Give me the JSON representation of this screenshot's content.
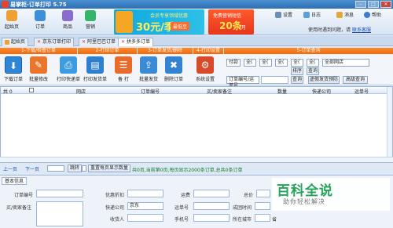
{
  "window": {
    "title": "易掌柜-订单打印 5.75"
  },
  "ribbon": {
    "buttons": [
      "起始页",
      "订单",
      "商品",
      "营销"
    ],
    "banner1": {
      "line1": "会员专享领域优惠",
      "price": "30元/季",
      "tag": "最低至"
    },
    "banner2": {
      "line1": "免费营销短信",
      "count": "20条",
      "unit": "/月"
    },
    "tools": [
      "设置",
      "日志",
      "消息",
      "帮助"
    ],
    "help_text": "使用时遇到问题，请",
    "help_link": "联系客服"
  },
  "tabs": [
    "起始页",
    "京东订单打印",
    "阿里巴巴订单",
    "拼多多订单"
  ],
  "groups": [
    "1-下载/检查订单",
    "2-打印订单",
    "3-订单发货/删除",
    "4-打印设置",
    "5-订单查询"
  ],
  "toolbar": [
    "下载订单",
    "批量修改",
    "打印快递单",
    "打印发货单",
    "备 打",
    "批量发货",
    "删除订单",
    "系统设置"
  ],
  "filters": {
    "row1": [
      "付款",
      "全(",
      "全(",
      "全(",
      "全(",
      "全(",
      "全部网店"
    ],
    "search_field": "订单编号/运单号",
    "buttons": [
      "排序",
      "查询",
      "查询",
      "虚假发货预防",
      "高级查询"
    ]
  },
  "table": {
    "columns": [
      "共 0",
      "网店",
      "订单编号",
      "买/卖家备注",
      "数量",
      "快递公司",
      "运单号"
    ]
  },
  "pager": {
    "prev": "上一页",
    "next": "下一页",
    "jump": "跳转",
    "page_size": "重置每页显示数量",
    "status": "共0页,当前第0页,每页显示2000条订单,总共0条订单"
  },
  "detail": {
    "tab": "基本信息",
    "labels": [
      "订单编号",
      "买/卖家备注",
      "优惠折扣",
      "运费",
      "总价",
      "快递公司",
      "运单号",
      "成团时间",
      "收货人",
      "手机号",
      "所在城市",
      "省"
    ],
    "courier_value": "京东"
  },
  "watermark": {
    "title": "百科全说",
    "subtitle": "助你轻松解决"
  }
}
